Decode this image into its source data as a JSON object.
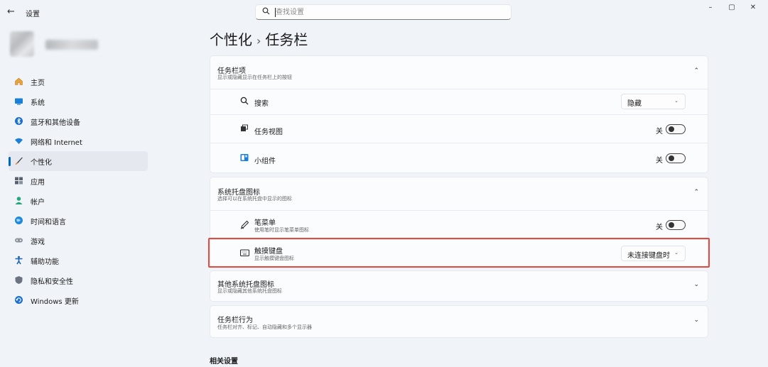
{
  "titlebar": {
    "back_label": "←",
    "app_title": "设置",
    "search_placeholder": "查找设置",
    "minimize": "–",
    "maximize": "▢",
    "close": "✕"
  },
  "sidebar": {
    "items": [
      {
        "label": "主页",
        "icon": "home-icon"
      },
      {
        "label": "系统",
        "icon": "system-icon"
      },
      {
        "label": "蓝牙和其他设备",
        "icon": "bluetooth-icon"
      },
      {
        "label": "网络和 Internet",
        "icon": "wifi-icon"
      },
      {
        "label": "个性化",
        "icon": "brush-icon"
      },
      {
        "label": "应用",
        "icon": "apps-icon"
      },
      {
        "label": "帐户",
        "icon": "account-icon"
      },
      {
        "label": "时间和语言",
        "icon": "globe-icon"
      },
      {
        "label": "游戏",
        "icon": "gamepad-icon"
      },
      {
        "label": "辅助功能",
        "icon": "accessibility-icon"
      },
      {
        "label": "隐私和安全性",
        "icon": "shield-icon"
      },
      {
        "label": "Windows 更新",
        "icon": "update-icon"
      }
    ],
    "active": "个性化"
  },
  "breadcrumb": {
    "parent": "个性化",
    "separator": "›",
    "current": "任务栏"
  },
  "taskbar_items": {
    "title": "任务栏项",
    "subtitle": "显示或隐藏显示在任务栏上的按钮",
    "rows": [
      {
        "label": "搜索",
        "control": "dropdown",
        "value": "隐藏"
      },
      {
        "label": "任务视图",
        "control": "toggle",
        "state_label": "关"
      },
      {
        "label": "小组件",
        "control": "toggle",
        "state_label": "关"
      }
    ]
  },
  "tray_icons": {
    "title": "系统托盘图标",
    "subtitle": "选择可以在系统托盘中显示的图标",
    "rows": [
      {
        "label": "笔菜单",
        "sub": "使用笔时显示笔菜单图标",
        "control": "toggle",
        "state_label": "关"
      },
      {
        "label": "触摸键盘",
        "sub": "显示触摸键盘图标",
        "control": "dropdown",
        "value": "未连接键盘时"
      }
    ]
  },
  "other_tray": {
    "title": "其他系统托盘图标",
    "subtitle": "显示或隐藏其他系统托盘图标"
  },
  "behaviors": {
    "title": "任务栏行为",
    "subtitle": "任务栏对齐、标记、自动隐藏和多个显示器"
  },
  "related": {
    "title": "相关设置"
  },
  "colors": {
    "accent": "#0067c0",
    "highlight": "#e24b3f",
    "background": "#f0f4f9"
  }
}
